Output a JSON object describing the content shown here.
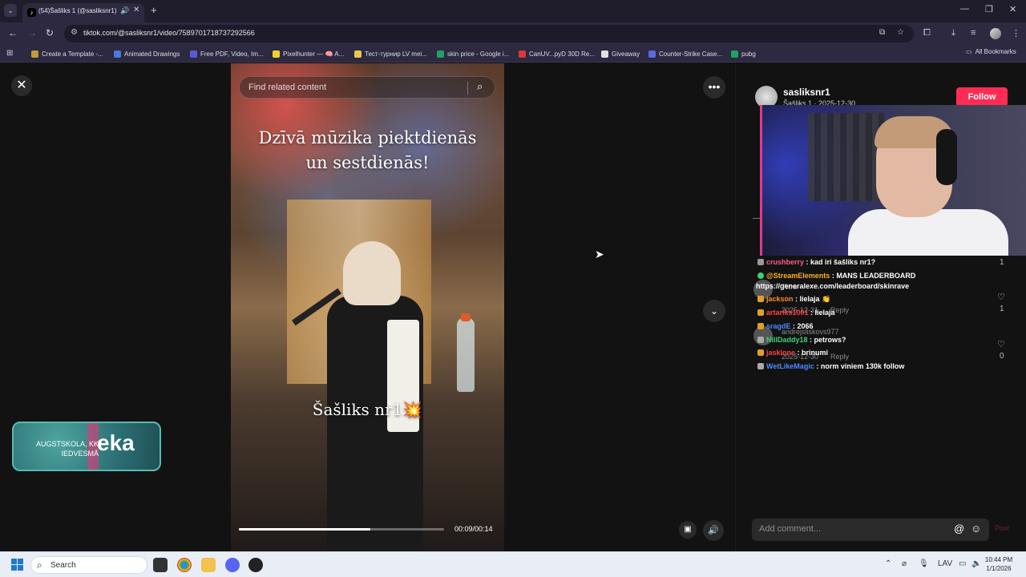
{
  "browser": {
    "tab_title": "(54)Šašliks 1 (@sasliksnr1) |",
    "url": "tiktok.com/@sasliksnr1/video/7589701718737292566",
    "bookmarks": [
      {
        "label": "Create a Template -...",
        "color": "#c49a3a"
      },
      {
        "label": "Animated Drawings",
        "color": "#4a78e0"
      },
      {
        "label": "Free PDF, Video, Im...",
        "color": "#5a5ad6"
      },
      {
        "label": "Pixelhunter — 🧠 A...",
        "color": "#f2d22a"
      },
      {
        "label": "Тест-турнир LV mei...",
        "color": "#e8c84a"
      },
      {
        "label": "skin price - Google i...",
        "color": "#1ea362"
      },
      {
        "label": "CanUV...pyD 30D Re...",
        "color": "#d93a3a"
      },
      {
        "label": "Giveaway",
        "color": "#e0e0e0"
      },
      {
        "label": "Counter-Strike Case...",
        "color": "#5a6ae0"
      },
      {
        "label": "pubg",
        "color": "#1ea362"
      }
    ],
    "all_bookmarks": "All Bookmarks"
  },
  "video": {
    "search_placeholder": "Find related content",
    "caption_line1": "Dzīvā mūzika piektdienās",
    "caption_line2": "un sestdienās!",
    "overlay_name": "Šašliks nr1💥",
    "time": "00:09/00:14",
    "progress": 0.64
  },
  "badge": {
    "sub_line1": "AUGSTSKOLA, KK",
    "sub_line2": "IEDVESMĀ",
    "word": "eka"
  },
  "author": {
    "username": "sasliksnr1",
    "meta": "Šašliks 1 · 2025-12-30",
    "follow_label": "Follow"
  },
  "chat": [
    {
      "user": "crushberry",
      "text": "kad iri šašliks nr1?",
      "color": "#ff5a8a",
      "icon": "#999999"
    },
    {
      "user": "@StreamElements",
      "text": "MANS LEADERBOARD",
      "color": "#ffb020",
      "icon": "#3ad07a"
    },
    {
      "user": "",
      "text": "https://generalexe.com/leaderboard/skinrave",
      "color": "#ffffff",
      "icon": ""
    },
    {
      "user": "jackson",
      "text": "lielaja 👏",
      "color": "#ff8a2a",
      "icon": "#e0a020"
    },
    {
      "user": "artariks1001",
      "text": "lielaja",
      "color": "#ff4040",
      "icon": "#e0a020"
    },
    {
      "user": "sragdE",
      "text": "2066",
      "color": "#4a8aff",
      "icon": "#e0a020"
    },
    {
      "user": "NillDaddy18",
      "text": "petrows?",
      "color": "#3ad07a",
      "icon": "#aaaaaa"
    },
    {
      "user": "jasklone",
      "text": "brinumi",
      "color": "#ff4040",
      "icon": "#e0a020"
    },
    {
      "user": "WetLikeMagic",
      "text": "norm viniem 130k follow",
      "color": "#4a8aff",
      "icon": "#aaaaaa"
    }
  ],
  "comments": [
    {
      "date": "2025-12-31",
      "reply": "Reply",
      "likes": "1",
      "name": "Tiitra"
    },
    {
      "date": "2025-12-30",
      "reply": "Reply",
      "likes": "0",
      "name": "andrejsliskovs977"
    }
  ],
  "comments_top_count": "1",
  "comment_placeholder": "Add comment...",
  "post_label": "Post",
  "taskbar": {
    "search": "Search",
    "lang": "LAV",
    "time": "10:44 PM",
    "date": "1/1/2026"
  }
}
